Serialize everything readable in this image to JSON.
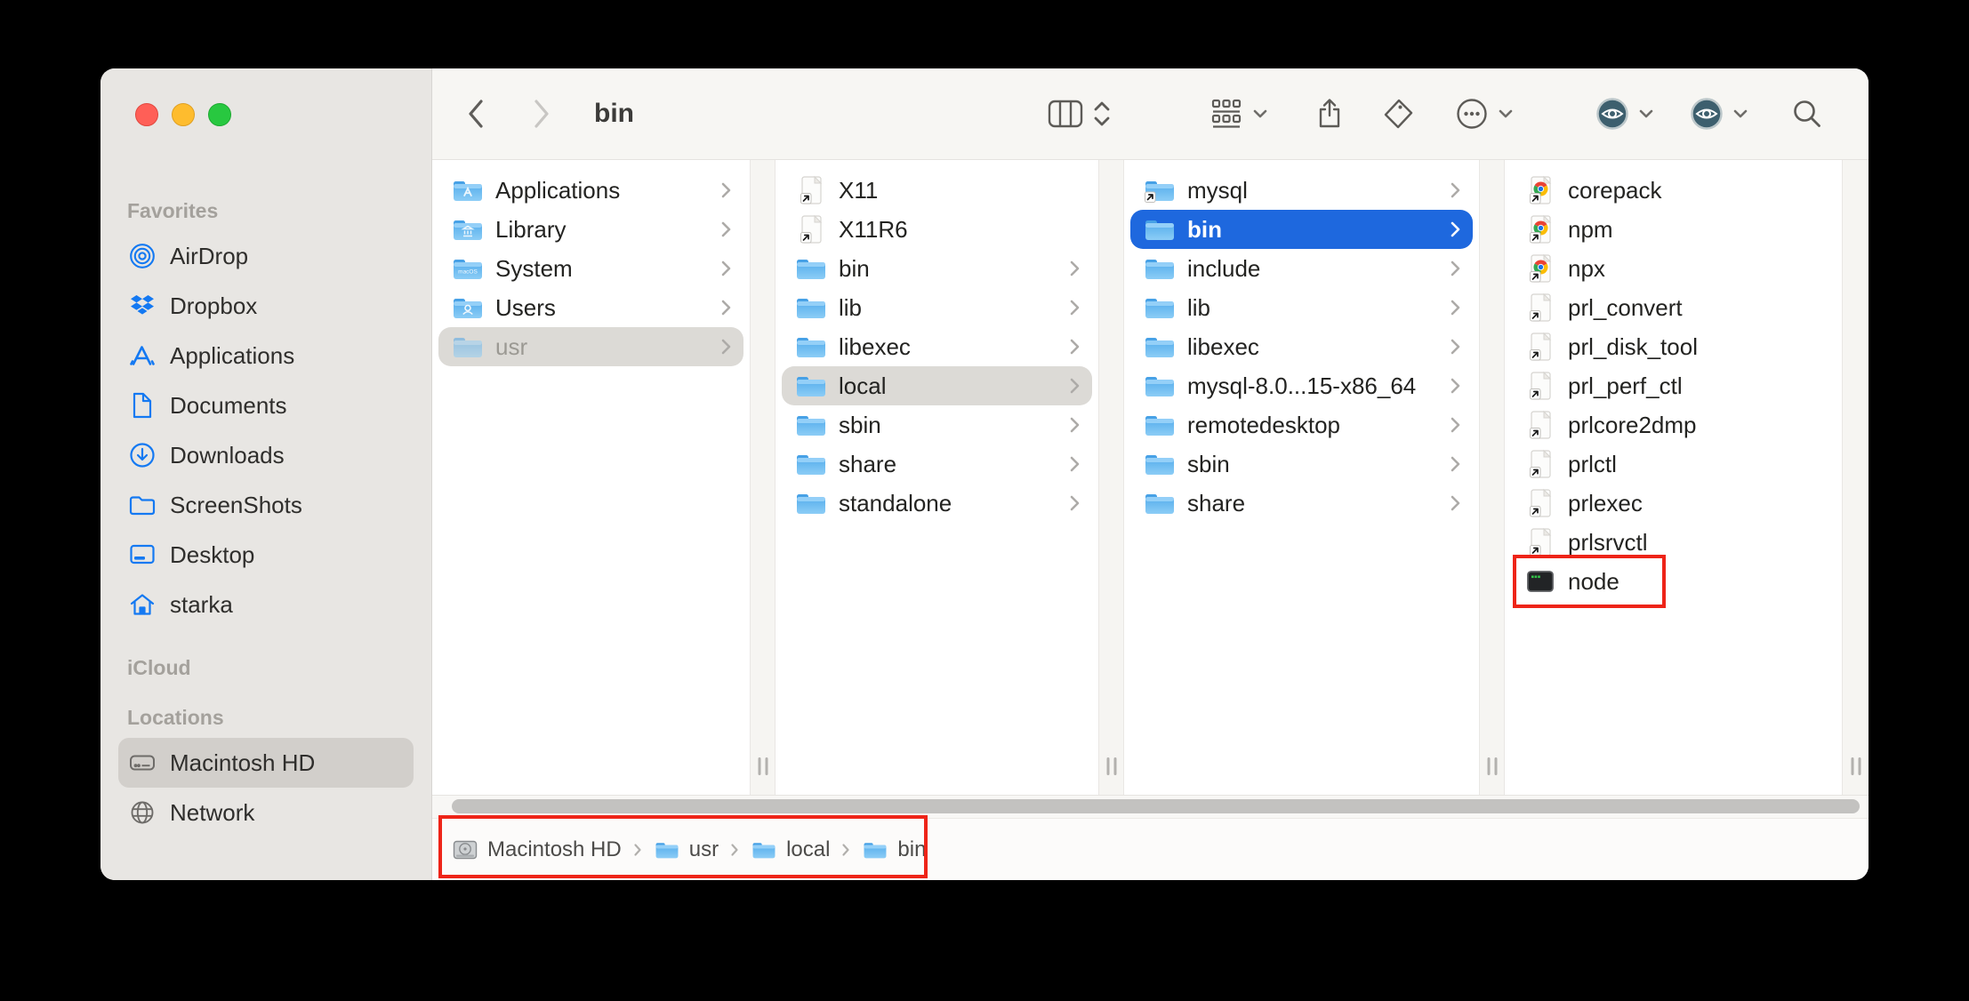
{
  "window": {
    "title": "bin",
    "controls": [
      "close",
      "minimize",
      "zoom"
    ]
  },
  "sidebar": {
    "sections": [
      {
        "label": "Favorites",
        "items": [
          {
            "icon": "airdrop",
            "label": "AirDrop"
          },
          {
            "icon": "dropbox",
            "label": "Dropbox"
          },
          {
            "icon": "appstore",
            "label": "Applications"
          },
          {
            "icon": "document",
            "label": "Documents"
          },
          {
            "icon": "download",
            "label": "Downloads"
          },
          {
            "icon": "folder-outline",
            "label": "ScreenShots"
          },
          {
            "icon": "desktop",
            "label": "Desktop"
          },
          {
            "icon": "home",
            "label": "starka"
          }
        ]
      },
      {
        "label": "iCloud",
        "items": []
      },
      {
        "label": "Locations",
        "items": [
          {
            "icon": "drive",
            "label": "Macintosh HD",
            "selected": true
          },
          {
            "icon": "globe",
            "label": "Network"
          }
        ]
      }
    ]
  },
  "toolbar": {
    "title": "bin",
    "icons": [
      "back-icon",
      "forward-icon",
      "columns-view-icon",
      "view-stepper-icon",
      "group-icon",
      "chevron-down-icon",
      "share-icon",
      "tag-icon",
      "more-icon",
      "chevron-down-icon",
      "preview-eye-icon",
      "chevron-down-icon",
      "preview-eye-icon",
      "chevron-down-icon",
      "search-icon"
    ]
  },
  "columns": [
    {
      "items": [
        {
          "icon": "folder-apps",
          "label": "Applications",
          "chevron": true
        },
        {
          "icon": "folder-library",
          "label": "Library",
          "chevron": true
        },
        {
          "icon": "folder-system",
          "label": "System",
          "chevron": true
        },
        {
          "icon": "folder-users",
          "label": "Users",
          "chevron": true
        },
        {
          "icon": "folder",
          "label": "usr",
          "chevron": true,
          "state": "selected-inactive",
          "faded": true
        }
      ]
    },
    {
      "items": [
        {
          "icon": "alias-doc",
          "label": "X11"
        },
        {
          "icon": "alias-doc",
          "label": "X11R6"
        },
        {
          "icon": "folder",
          "label": "bin",
          "chevron": true
        },
        {
          "icon": "folder",
          "label": "lib",
          "chevron": true
        },
        {
          "icon": "folder",
          "label": "libexec",
          "chevron": true
        },
        {
          "icon": "folder",
          "label": "local",
          "chevron": true,
          "state": "selected-inactive"
        },
        {
          "icon": "folder",
          "label": "sbin",
          "chevron": true
        },
        {
          "icon": "folder",
          "label": "share",
          "chevron": true
        },
        {
          "icon": "folder",
          "label": "standalone",
          "chevron": true
        }
      ]
    },
    {
      "items": [
        {
          "icon": "folder-alias",
          "label": "mysql",
          "chevron": true
        },
        {
          "icon": "folder",
          "label": "bin",
          "chevron": true,
          "state": "selected-active"
        },
        {
          "icon": "folder",
          "label": "include",
          "chevron": true
        },
        {
          "icon": "folder",
          "label": "lib",
          "chevron": true
        },
        {
          "icon": "folder",
          "label": "libexec",
          "chevron": true
        },
        {
          "icon": "folder",
          "label": "mysql-8.0...15-x86_64",
          "chevron": true
        },
        {
          "icon": "folder",
          "label": "remotedesktop",
          "chevron": true
        },
        {
          "icon": "folder",
          "label": "sbin",
          "chevron": true
        },
        {
          "icon": "folder",
          "label": "share",
          "chevron": true
        }
      ]
    },
    {
      "items": [
        {
          "icon": "chrome-doc",
          "label": "corepack"
        },
        {
          "icon": "chrome-doc",
          "label": "npm"
        },
        {
          "icon": "chrome-doc",
          "label": "npx"
        },
        {
          "icon": "alias-doc",
          "label": "prl_convert"
        },
        {
          "icon": "alias-doc",
          "label": "prl_disk_tool"
        },
        {
          "icon": "alias-doc",
          "label": "prl_perf_ctl"
        },
        {
          "icon": "alias-doc",
          "label": "prlcore2dmp"
        },
        {
          "icon": "alias-doc",
          "label": "prlctl"
        },
        {
          "icon": "alias-doc",
          "label": "prlexec"
        },
        {
          "icon": "alias-doc",
          "label": "prlsrvctl"
        },
        {
          "icon": "terminal",
          "label": "node",
          "annotated": true
        }
      ]
    }
  ],
  "pathbar": {
    "separator": "›",
    "items": [
      {
        "icon": "drive-color",
        "label": "Macintosh HD"
      },
      {
        "icon": "folder-small",
        "label": "usr"
      },
      {
        "icon": "folder-small",
        "label": "local"
      },
      {
        "icon": "folder-small",
        "label": "bin"
      }
    ]
  },
  "annotations": [
    "node-row-highlight",
    "path-bar-highlight"
  ],
  "colors": {
    "accent_blue": "#1e68de",
    "selection_gray": "#dcdad6",
    "annotation_red": "#ee2418",
    "folder_blue": "#5fb2ee",
    "sidebar_icon_blue": "#1479f2",
    "eye_badge": "#3d5f6e",
    "sidebar_bg": "#e8e6e3",
    "toolbar_bg": "#f7f6f3"
  }
}
